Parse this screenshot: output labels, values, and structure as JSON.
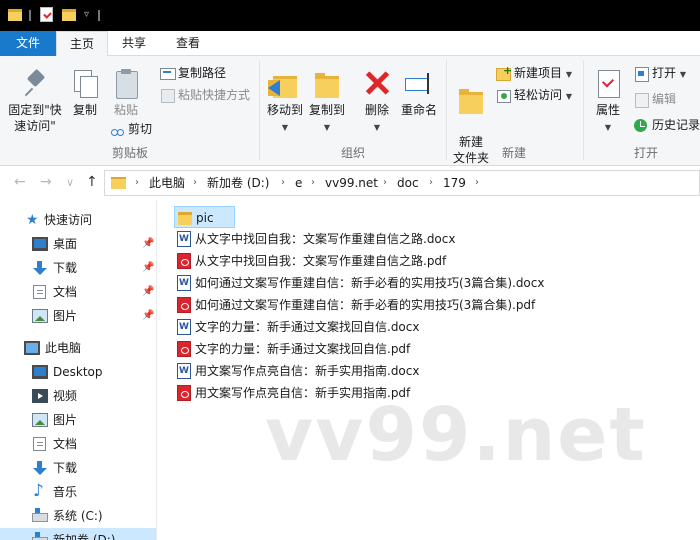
{
  "window": {
    "qat_arrow": "▿"
  },
  "ribbon_tabs": {
    "file": "文件",
    "home": "主页",
    "share": "共享",
    "view": "查看"
  },
  "clipboard": {
    "pin": "固定到\"快速访问\"",
    "copy": "复制",
    "paste": "粘贴",
    "copy_path": "复制路径",
    "paste_shortcut": "粘贴快捷方式",
    "cut": "剪切",
    "label": "剪贴板"
  },
  "organize": {
    "move_to": "移动到",
    "copy_to": "复制到",
    "delete": "删除",
    "rename": "重命名",
    "label": "组织"
  },
  "new_group": {
    "new_folder": "新建\n文件夹",
    "new_item": "新建项目",
    "easy_access": "轻松访问",
    "label": "新建"
  },
  "open_group": {
    "properties": "属性",
    "open": "打开",
    "edit": "编辑",
    "history": "历史记录",
    "label": "打开"
  },
  "nav": {
    "back": "←",
    "forward": "→",
    "recent": "∨",
    "up": "↑"
  },
  "breadcrumb": [
    "此电脑",
    "新加卷 (D:)",
    "e",
    "vv99.net",
    "doc",
    "179"
  ],
  "sidebar": {
    "quick_access": "快速访问",
    "quick_items": [
      {
        "label": "桌面",
        "icon": "desktop-icon"
      },
      {
        "label": "下载",
        "icon": "download-icon"
      },
      {
        "label": "文档",
        "icon": "documents-icon"
      },
      {
        "label": "图片",
        "icon": "pictures-icon"
      }
    ],
    "pin_glyph": "📌",
    "this_pc": "此电脑",
    "pc_items": [
      {
        "label": "Desktop",
        "icon": "desktop-icon"
      },
      {
        "label": "视频",
        "icon": "video-icon"
      },
      {
        "label": "图片",
        "icon": "pictures-icon"
      },
      {
        "label": "文档",
        "icon": "documents-icon"
      },
      {
        "label": "下载",
        "icon": "download-icon"
      },
      {
        "label": "音乐",
        "icon": "music-icon"
      },
      {
        "label": "系统 (C:)",
        "icon": "drive-icon"
      },
      {
        "label": "新加卷 (D:)",
        "icon": "drive-icon"
      }
    ]
  },
  "files": [
    {
      "name": "pic",
      "type": "folder"
    },
    {
      "name": "从文字中找回自我：文案写作重建自信之路.docx",
      "type": "word"
    },
    {
      "name": "从文字中找回自我：文案写作重建自信之路.pdf",
      "type": "pdf"
    },
    {
      "name": "如何通过文案写作重建自信：新手必看的实用技巧(3篇合集).docx",
      "type": "word"
    },
    {
      "name": "如何通过文案写作重建自信：新手必看的实用技巧(3篇合集).pdf",
      "type": "pdf"
    },
    {
      "name": "文字的力量：新手通过文案找回自信.docx",
      "type": "word"
    },
    {
      "name": "文字的力量：新手通过文案找回自信.pdf",
      "type": "pdf"
    },
    {
      "name": "用文案写作点亮自信：新手实用指南.docx",
      "type": "word"
    },
    {
      "name": "用文案写作点亮自信：新手实用指南.pdf",
      "type": "pdf"
    }
  ],
  "watermark": "vv99.net",
  "colors": {
    "accent": "#1979ca",
    "selection": "#cce8ff",
    "folder": "#f6cf5c",
    "pdf": "#d9252e",
    "word": "#2b5797"
  }
}
